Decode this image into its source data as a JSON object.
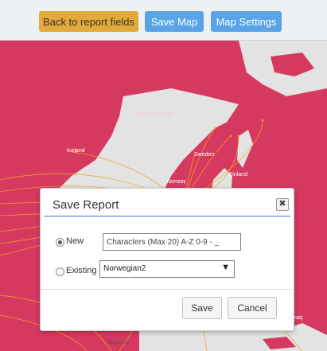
{
  "toolbar": {
    "back_label": "Back to report fields",
    "save_map_label": "Save Map",
    "map_settings_label": "Map Settings"
  },
  "map": {
    "labels": {
      "norwegian_sea": "Norwegian Sea",
      "iceland": "Iceland",
      "sweden": "Sweden",
      "finland": "Finland",
      "norway": "Norway",
      "marocco": "Marocco",
      "iraq": "Iraq"
    },
    "colors": {
      "land": "#d6395f",
      "water": "#e3e3e3",
      "routes": "#f5a623"
    }
  },
  "dialog": {
    "title": "Save Report",
    "close_glyph": "✖",
    "new_label": "New",
    "new_placeholder": "Characters (Max 20) A-Z 0-9 - _",
    "existing_label": "Existing",
    "existing_value": "Norwegian2",
    "existing_caret": "▼",
    "save_label": "Save",
    "cancel_label": "Cancel"
  }
}
